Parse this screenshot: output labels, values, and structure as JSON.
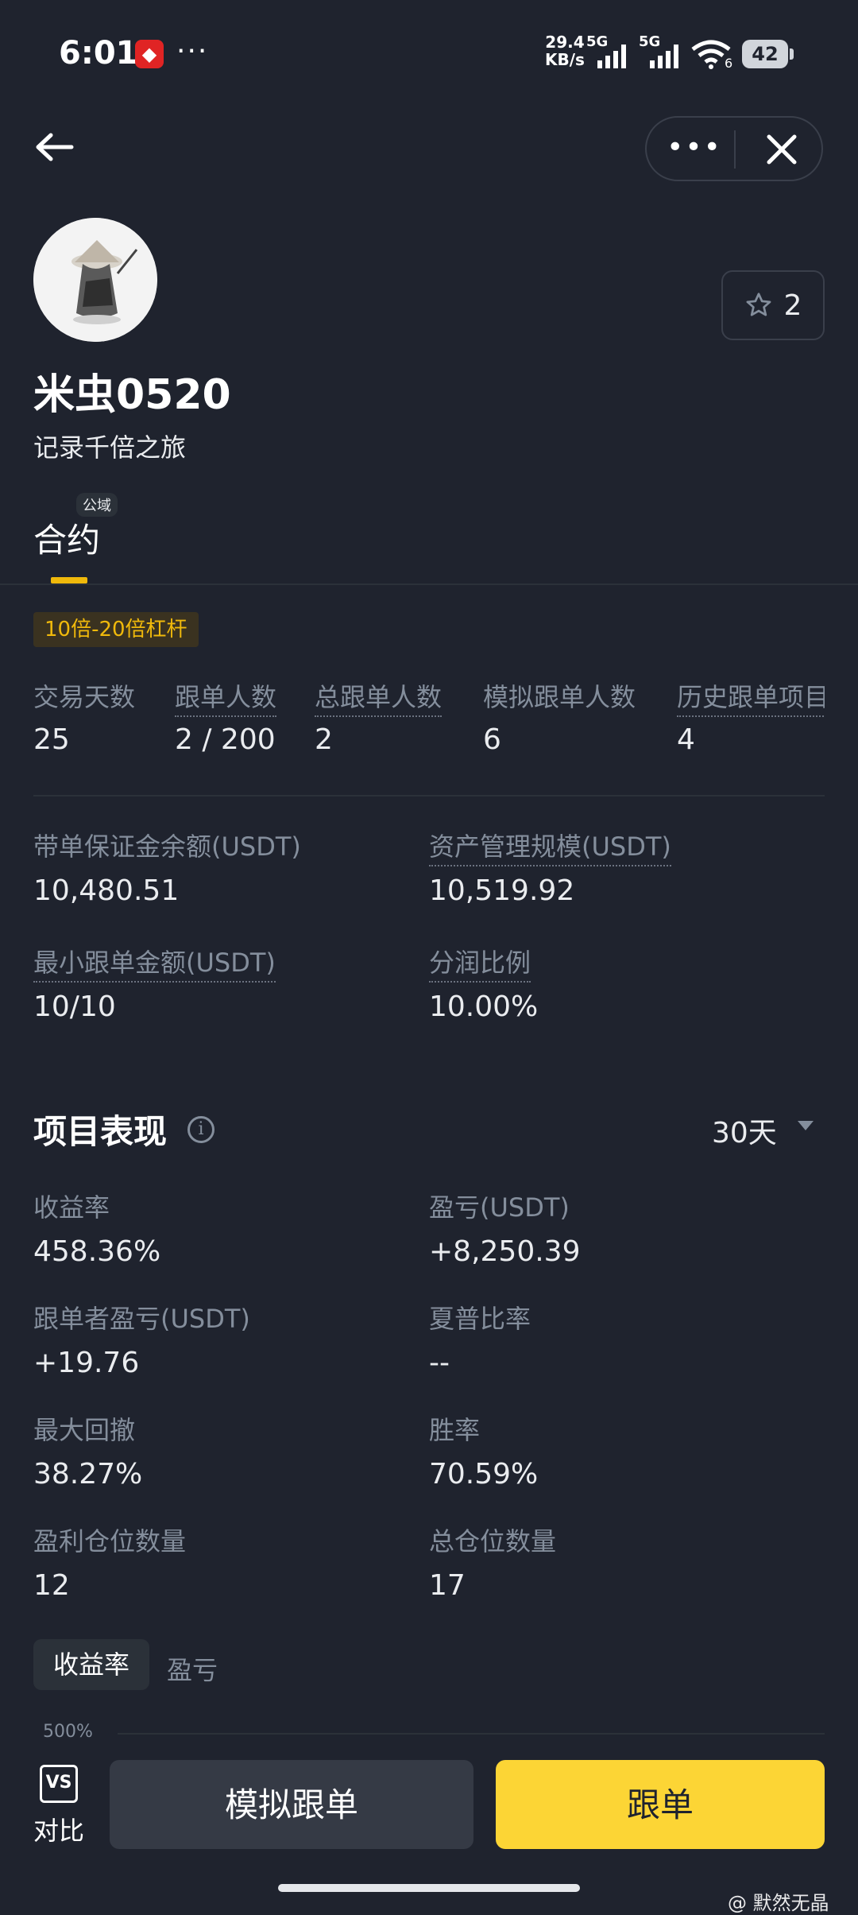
{
  "status_bar": {
    "time": "6:01",
    "net_speed_value": "29.4",
    "net_speed_unit": "KB/s",
    "signal_1_label": "5G",
    "signal_2_label": "5G",
    "wifi_level": "6",
    "battery": "42"
  },
  "nav": {
    "back_icon": "arrow-left-icon",
    "more_label": "•••",
    "close_icon": "close-icon"
  },
  "profile": {
    "name": "米虫0520",
    "bio": "记录千倍之旅",
    "favorites_count": "2"
  },
  "tabs": {
    "badge": "公域",
    "active_label": "合约"
  },
  "leverage_tag": "10倍-20倍杠杆",
  "stats": [
    {
      "label": "交易天数",
      "value": "25"
    },
    {
      "label": "跟单人数",
      "value": "2 / 200"
    },
    {
      "label": "总跟单人数",
      "value": "2"
    },
    {
      "label": "模拟跟单人数",
      "value": "6"
    },
    {
      "label": "历史跟单项目",
      "value": "4"
    }
  ],
  "account": {
    "margin_balance_label": "带单保证金余额(USDT)",
    "margin_balance_value": "10,480.51",
    "aum_label": "资产管理规模(USDT)",
    "aum_value": "10,519.92",
    "min_copy_label": "最小跟单金额(USDT)",
    "min_copy_value": "10/10",
    "profit_share_label": "分润比例",
    "profit_share_value": "10.00%"
  },
  "performance": {
    "title": "项目表现",
    "period": "30天",
    "roi_label": "收益率",
    "roi_value": "458.36%",
    "pnl_label": "盈亏(USDT)",
    "pnl_value": "+8,250.39",
    "follower_pnl_label": "跟单者盈亏(USDT)",
    "follower_pnl_value": "+19.76",
    "sharpe_label": "夏普比率",
    "sharpe_value": "--",
    "max_drawdown_label": "最大回撤",
    "max_drawdown_value": "38.27%",
    "win_rate_label": "胜率",
    "win_rate_value": "70.59%",
    "win_positions_label": "盈利仓位数量",
    "win_positions_value": "12",
    "total_positions_label": "总仓位数量",
    "total_positions_value": "17"
  },
  "chart_tabs": {
    "active": "收益率",
    "other": "盈亏",
    "y_tick_top": "500%"
  },
  "bottom": {
    "compare_icon_text": "VS",
    "compare_label": "对比",
    "simulate_button": "模拟跟单",
    "follow_button": "跟单"
  },
  "watermark": "@ 默然无晶",
  "colors": {
    "background": "#1f232e",
    "accent_yellow": "#fcd535",
    "positive_green": "#2ebd85",
    "muted_text": "#848e9c"
  }
}
